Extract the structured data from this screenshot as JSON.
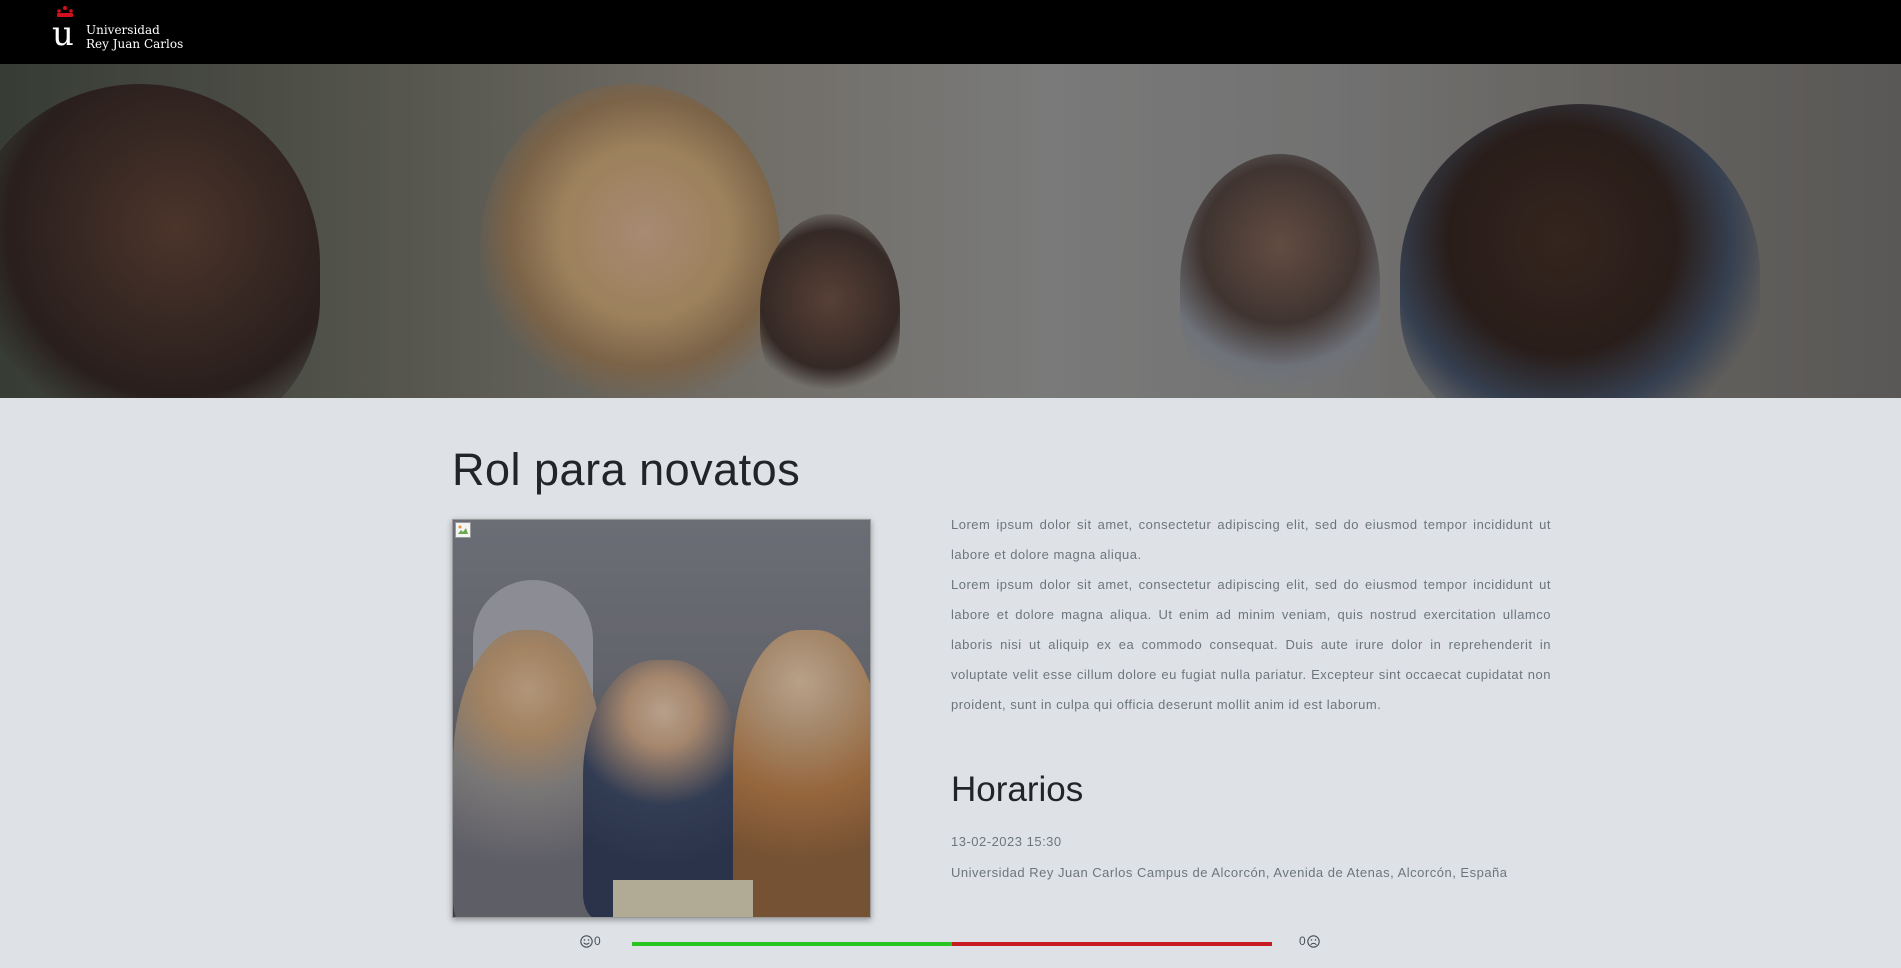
{
  "header": {
    "logo_letter": "u",
    "logo_line1": "Universidad",
    "logo_line2": "Rey Juan Carlos"
  },
  "event": {
    "title": "Rol para novatos",
    "description_1": "Lorem ipsum dolor sit amet, consectetur adipiscing elit, sed do eiusmod tempor incididunt ut labore et dolore magna aliqua.",
    "description_2": "Lorem ipsum dolor sit amet, consectetur adipiscing elit, sed do eiusmod tempor incididunt ut labore et dolore magna aliqua. Ut enim ad minim veniam, quis nostrud exercitation ullamco laboris nisi ut aliquip ex ea commodo consequat. Duis aute irure dolor in reprehenderit in voluptate velit esse cillum dolore eu fugiat nulla pariatur. Excepteur sint occaecat cupidatat non proident, sunt in culpa qui officia deserunt mollit anim id est laborum."
  },
  "schedule": {
    "heading": "Horarios",
    "datetime": "13-02-2023 15:30",
    "location": "Universidad Rey Juan Carlos Campus de Alcorcón, Avenida de Atenas, Alcorcón, España"
  },
  "rating": {
    "likes": "0",
    "dislikes": "0",
    "like_icon": "smile-icon",
    "dislike_icon": "frown-icon",
    "like_color": "#28c521",
    "dislike_color": "#c81b22",
    "like_share": 0.5
  },
  "colors": {
    "topbar": "#000000",
    "page_background": "#dee2e6",
    "brand_red": "#d0101a"
  }
}
